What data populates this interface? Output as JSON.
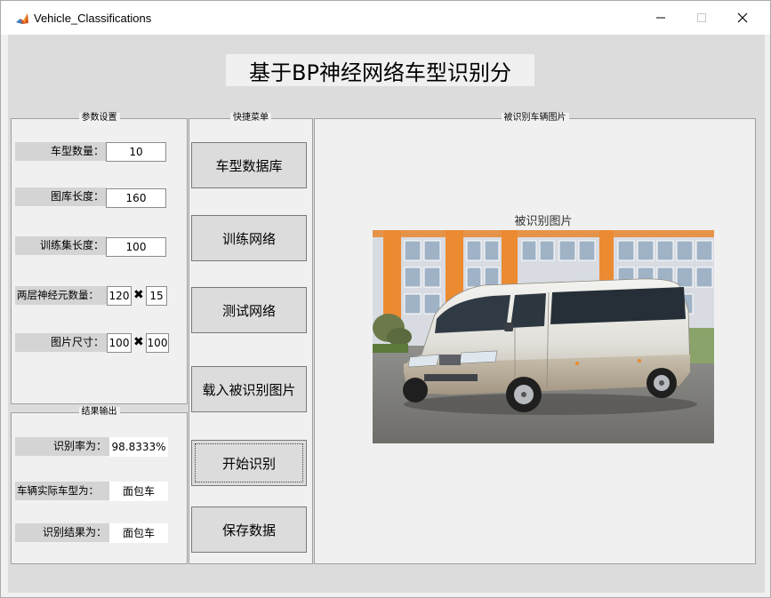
{
  "window": {
    "title": "Vehicle_Classifications",
    "min_icon": "minimize-icon",
    "max_icon": "maximize-icon",
    "close_icon": "close-icon"
  },
  "heading": "基于BP神经网络车型识别分",
  "params_panel": {
    "title": "参数设置",
    "vehicle_types_label": "车型数量：",
    "vehicle_types_value": "10",
    "library_length_label": "图库长度：",
    "library_length_value": "160",
    "training_length_label": "训练集长度：",
    "training_length_value": "100",
    "neurons_label": "两层神经元数量：",
    "neurons_layer1": "120",
    "neurons_layer2": "15",
    "image_size_label": "图片尺寸：",
    "image_width": "100",
    "image_height": "100",
    "times_symbol": "✖"
  },
  "results_panel": {
    "title": "结果输出",
    "rate_label": "识别率为：",
    "rate_value": "98.8333%",
    "actual_label": "车辆实际车型为：",
    "actual_value": "面包车",
    "result_label": "识别结果为：",
    "result_value": "面包车"
  },
  "menu_panel": {
    "title": "快捷菜单",
    "buttons": [
      "车型数据库",
      "训练网络",
      "测试网络",
      "载入被识别图片",
      "开始识别",
      "保存数据"
    ]
  },
  "image_panel": {
    "title": "被识别车辆图片",
    "axes_title": "被识别图片"
  },
  "colors": {
    "window_bg": "#dcdcdc",
    "panel_bg": "#f0f0f0",
    "button_bg": "#dcdcdc"
  }
}
